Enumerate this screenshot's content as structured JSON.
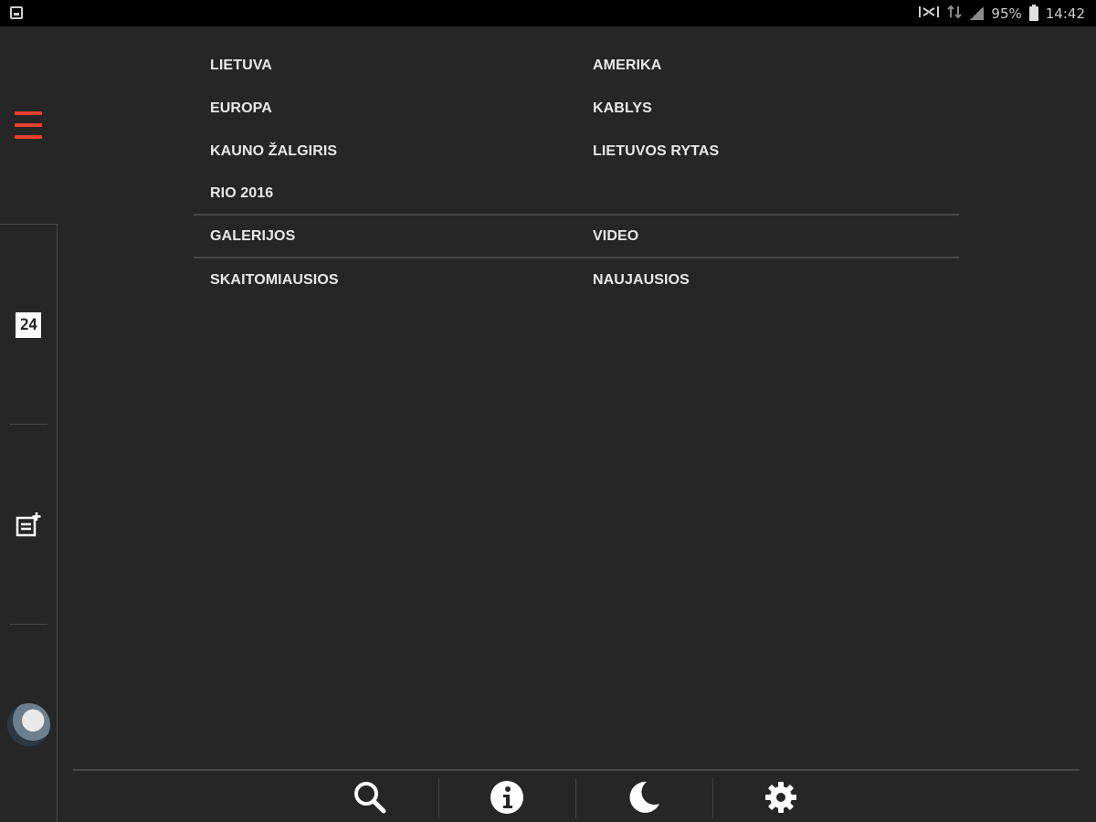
{
  "statusbar": {
    "battery": "95%",
    "time": "14:42",
    "icons": [
      "gallery-notification-icon",
      "mute-icon",
      "data-icon",
      "signal-icon",
      "battery-icon"
    ]
  },
  "rail": {
    "menu_icon": "hamburger-menu-icon",
    "items": [
      "news-24-icon",
      "add-article-icon",
      "user-avatar"
    ],
    "accent_color": "#e8402f"
  },
  "menu": {
    "rows": [
      [
        "LIETUVA",
        "AMERIKA"
      ],
      [
        "EUROPA",
        "KABLYS"
      ],
      [
        "KAUNO ŽALGIRIS",
        "LIETUVOS RYTAS"
      ],
      [
        "RIO 2016",
        ""
      ],
      [
        "GALERIJOS",
        "VIDEO"
      ],
      [
        "SKAITOMIAUSIOS",
        "NAUJAUSIOS"
      ]
    ]
  },
  "bottombar": {
    "buttons": [
      "search-icon",
      "info-icon",
      "night-mode-icon",
      "settings-icon"
    ]
  }
}
